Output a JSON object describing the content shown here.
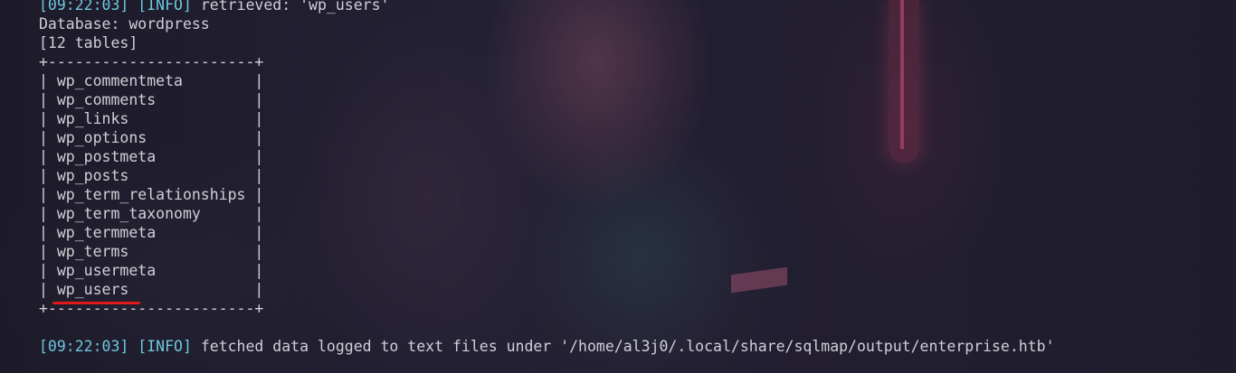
{
  "terminal": {
    "top_log": {
      "time": "[09:22:03]",
      "level": "[INFO]",
      "message": " retrieved: 'wp_users'"
    },
    "database_line": "Database: wordpress",
    "table_count_line": "[12 tables]",
    "table_border": "+-----------------------+",
    "table_rows": [
      "| wp_commentmeta        |",
      "| wp_comments           |",
      "| wp_links              |",
      "| wp_options            |",
      "| wp_postmeta           |",
      "| wp_posts              |",
      "| wp_term_relationships |",
      "| wp_term_taxonomy      |",
      "| wp_termmeta           |",
      "| wp_terms              |",
      "| wp_usermeta           |",
      "| wp_users              |"
    ],
    "bottom_log": {
      "time": "[09:22:03]",
      "level": "[INFO]",
      "message": " fetched data logged to text files under '/home/al3j0/.local/share/sqlmap/output/enterprise.htb'"
    },
    "highlight_color": "#e01a1a",
    "info_color": "#6ec7df"
  }
}
